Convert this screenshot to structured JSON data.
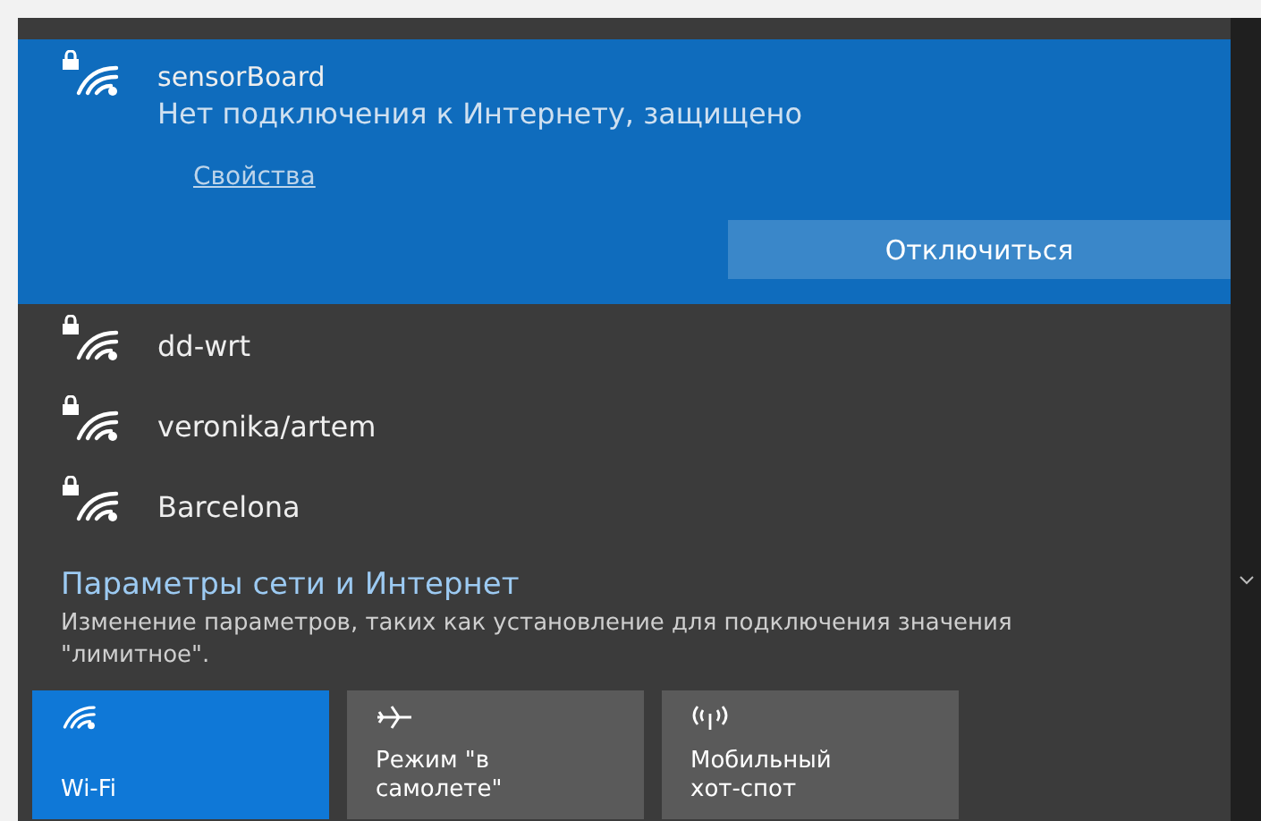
{
  "networks": [
    {
      "name": "sensorBoard",
      "status": "Нет подключения к Интернету, защищено",
      "link": "Свойства",
      "action": "Отключиться",
      "selected": true
    },
    {
      "name": "dd-wrt",
      "selected": false
    },
    {
      "name": "veronika/artem",
      "selected": false
    },
    {
      "name": "Barcelona",
      "selected": false
    }
  ],
  "settings": {
    "title": "Параметры сети и Интернет",
    "description": "Изменение параметров, таких как установление для подключения значения \"лимитное\"."
  },
  "tiles": [
    {
      "kind": "wifi",
      "label": "Wi-Fi",
      "on": true
    },
    {
      "kind": "airplane",
      "label": "Режим \"в самолете\"",
      "on": false
    },
    {
      "kind": "hotspot",
      "label": "Мобильный хот-спот",
      "on": false
    }
  ]
}
